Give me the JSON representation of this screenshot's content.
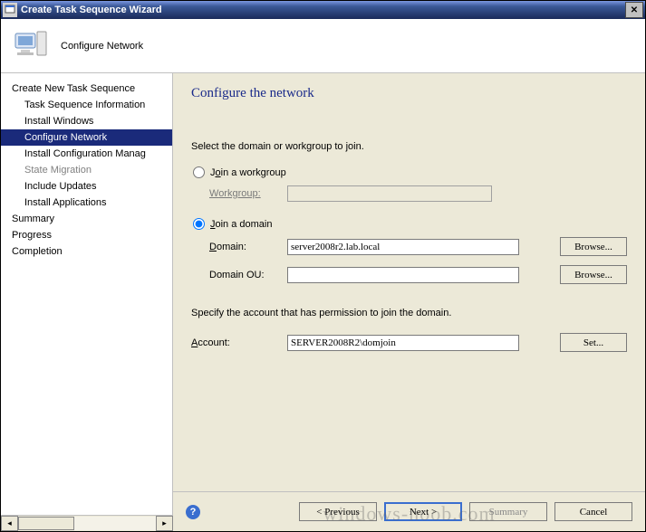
{
  "window": {
    "title": "Create Task Sequence Wizard"
  },
  "header": {
    "label": "Configure Network"
  },
  "sidebar": {
    "items": [
      {
        "label": "Create New Task Sequence",
        "sub": false,
        "sel": false,
        "dim": false
      },
      {
        "label": "Task Sequence Information",
        "sub": true,
        "sel": false,
        "dim": false
      },
      {
        "label": "Install Windows",
        "sub": true,
        "sel": false,
        "dim": false
      },
      {
        "label": "Configure Network",
        "sub": true,
        "sel": true,
        "dim": false
      },
      {
        "label": "Install Configuration Manag",
        "sub": true,
        "sel": false,
        "dim": false
      },
      {
        "label": "State Migration",
        "sub": true,
        "sel": false,
        "dim": true
      },
      {
        "label": "Include Updates",
        "sub": true,
        "sel": false,
        "dim": false
      },
      {
        "label": "Install Applications",
        "sub": true,
        "sel": false,
        "dim": false
      },
      {
        "label": "Summary",
        "sub": false,
        "sel": false,
        "dim": false
      },
      {
        "label": "Progress",
        "sub": false,
        "sel": false,
        "dim": false
      },
      {
        "label": "Completion",
        "sub": false,
        "sel": false,
        "dim": false
      }
    ]
  },
  "page": {
    "title": "Configure the network",
    "instruction": "Select the domain or workgroup to join.",
    "workgroup": {
      "radio_label": "Join a workgroup",
      "field_label": "Workgroup:",
      "value": ""
    },
    "domain": {
      "radio_label": "Join a domain",
      "domain_label": "Domain:",
      "domain_value": "server2008r2.lab.local",
      "ou_label": "Domain OU:",
      "ou_value": "",
      "browse_label": "Browse..."
    },
    "account": {
      "instruction": "Specify the account that has permission to join the domain.",
      "label": "Account:",
      "value": "SERVER2008R2\\domjoin",
      "set_label": "Set..."
    }
  },
  "footer": {
    "previous": "< Previous",
    "next": "Next >",
    "summary": "Summary",
    "cancel": "Cancel"
  },
  "watermark": "windows-noob.com"
}
